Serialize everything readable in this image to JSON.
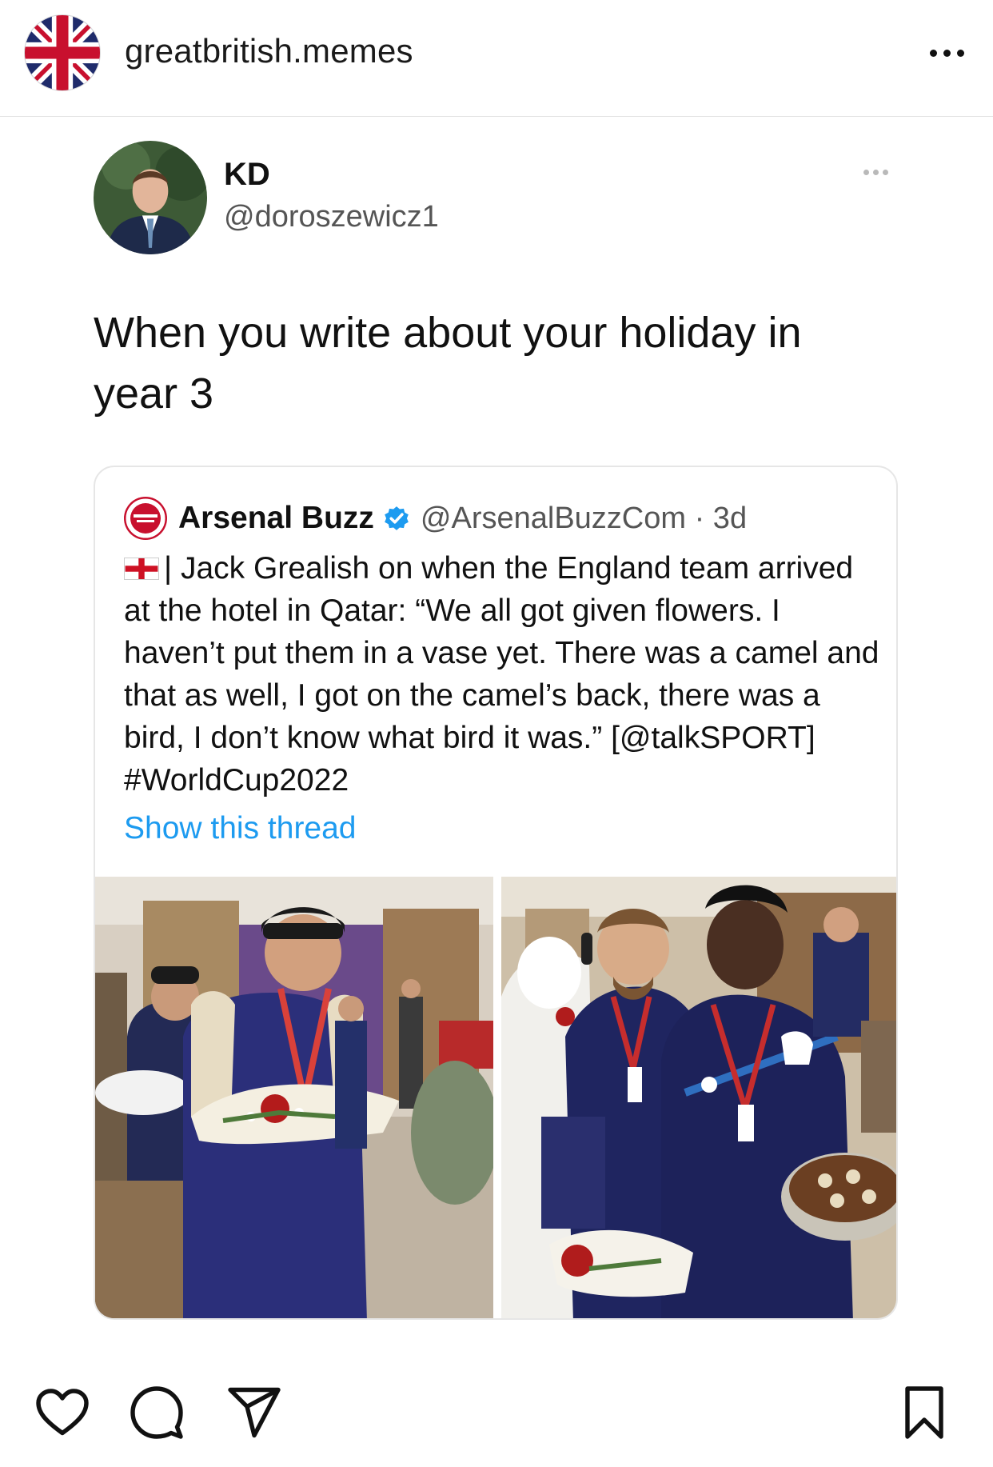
{
  "post_header": {
    "avatar_label": "greatbritish.memes profile picture",
    "username": "greatbritish.memes"
  },
  "tweet": {
    "display_name": "KD",
    "handle": "@doroszewicz1",
    "text": "When you write about your holiday in year 3"
  },
  "quoted_tweet": {
    "display_name": "Arsenal Buzz",
    "handle_and_time": "@ArsenalBuzzCom · 3d",
    "body": "| Jack Grealish on when the England team arrived at the hotel in Qatar: “We all got given flowers. I haven’t put them in a vase yet. There was a camel and that as well, I got on the camel’s back, there was a bird, I don’t know what bird it was.” [@talkSPORT] #WorldCup2022",
    "show_thread": "Show this thread"
  },
  "colors": {
    "link_blue": "#1d9bf0",
    "verified_blue": "#1d9bf0",
    "text_dark": "#111111",
    "text_muted": "#555555"
  },
  "icons": {
    "more": "more-horizontal-icon",
    "like": "heart-icon",
    "comment": "comment-bubble-icon",
    "share": "paper-plane-icon",
    "save": "bookmark-icon",
    "verified": "verified-badge-icon",
    "flag": "england-flag-icon"
  }
}
